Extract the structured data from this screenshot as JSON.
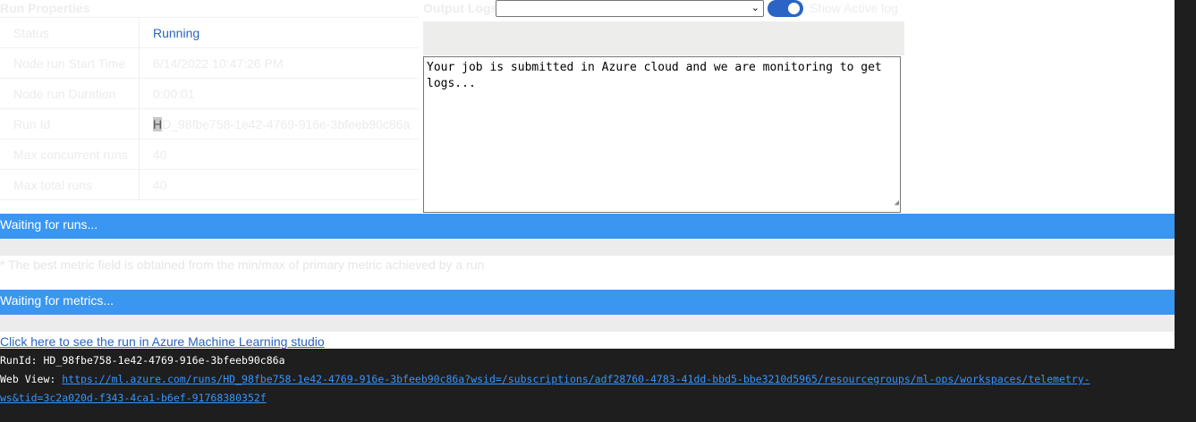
{
  "run_properties": {
    "title": "Run Properties",
    "rows": [
      {
        "key": "Status",
        "value": "Running"
      },
      {
        "key": "Node run Start Time",
        "value": "6/14/2022 10:47:26 PM"
      },
      {
        "key": "Node run Duration",
        "value": "0:00:01"
      },
      {
        "key": "Run Id",
        "value_first": "H",
        "value_rest": "D_98fbe758-1e42-4769-916e-3bfeeb90c86a"
      },
      {
        "key": "Max concurrent runs",
        "value": "40"
      },
      {
        "key": "Max total runs",
        "value": "40"
      }
    ]
  },
  "output_logs": {
    "title": "Output Logs",
    "dropdown_value": "",
    "toggle_label": "Show Active log",
    "toggle_on": true,
    "log_text": "Your job is submitted in Azure cloud and we are monitoring to get logs..."
  },
  "sections": {
    "runs_status": "Waiting for runs...",
    "best_metric_note": "* The best metric field is obtained from the min/max of primary metric achieved by a run",
    "metrics_status": "Waiting for metrics..."
  },
  "aml_link": "Click here to see the run in Azure Machine Learning studio",
  "console": {
    "runid_label": "RunId:",
    "runid_value": "HD_98fbe758-1e42-4769-916e-3bfeeb90c86a",
    "webview_label": "Web View:",
    "webview_url_line1": "https://ml.azure.com/runs/HD_98fbe758-1e42-4769-916e-3bfeeb90c86a?wsid=/subscriptions/adf28760-4783-41dd-bbd5-bbe3210d5965/resourcegroups/ml-ops/workspaces/telemetry-",
    "webview_url_line2": "ws&tid=3c2a020d-f343-4ca1-b6ef-91768380352f"
  },
  "colors": {
    "accent_blue": "#3a96f0",
    "link_blue": "#2b64c5",
    "console_bg": "#1e1e1e"
  }
}
